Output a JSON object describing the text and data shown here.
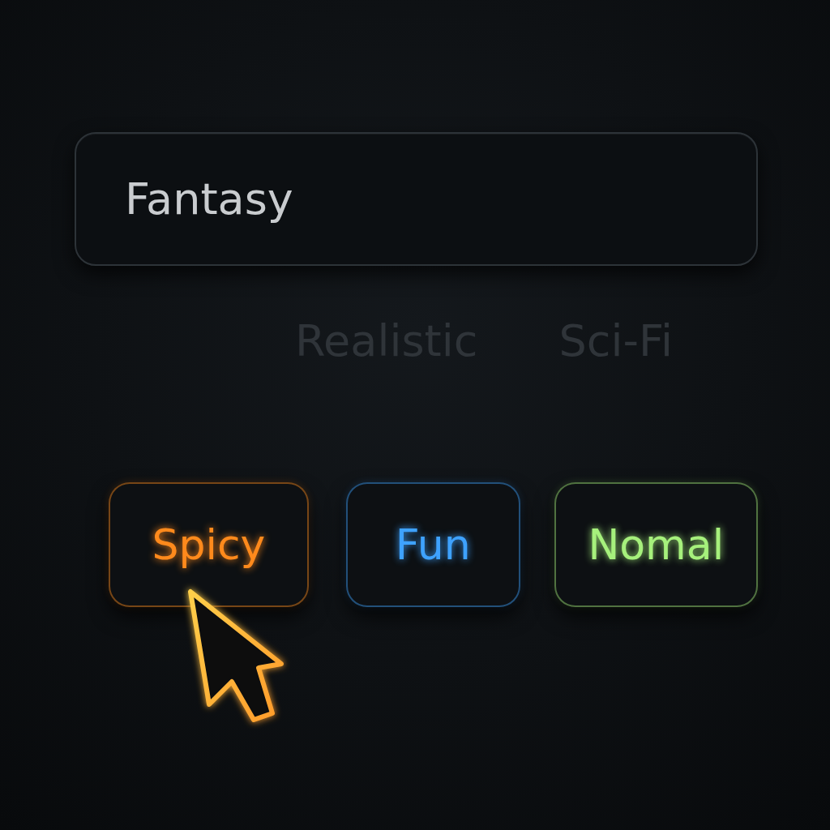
{
  "field": {
    "value": "Fantasy"
  },
  "suggestions": [
    {
      "label": "Realistic"
    },
    {
      "label": "Sci-Fi"
    }
  ],
  "buttons": [
    {
      "label": "Spicy",
      "color": "#ff8a1c"
    },
    {
      "label": "Fun",
      "color": "#3ea2ff"
    },
    {
      "label": "Nomal",
      "color": "#a6f07c"
    }
  ]
}
